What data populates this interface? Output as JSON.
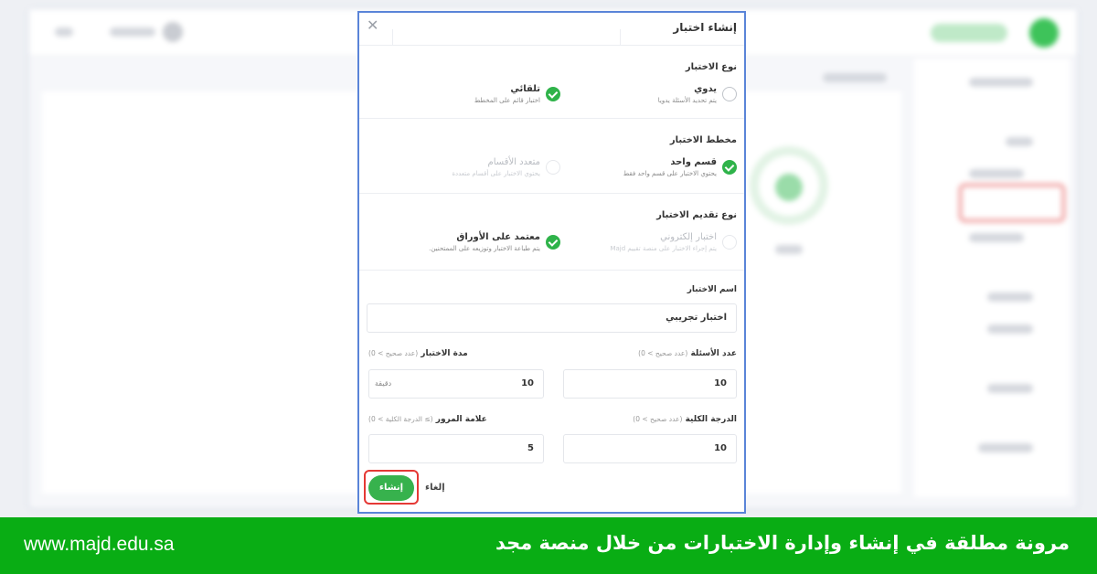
{
  "dialog": {
    "title": "إنشاء اختبار",
    "close_icon": "close-icon",
    "test_type": {
      "title": "نوع الاختبار",
      "manual": {
        "label": "يدوي",
        "desc": "يتم تحديد الأسئلة يدويا",
        "selected": false
      },
      "automatic": {
        "label": "تلقائي",
        "desc": "اختبار قائم على المخطط",
        "selected": true
      }
    },
    "test_plan": {
      "title": "مخطط الاختبار",
      "single": {
        "label": "قسم واحد",
        "desc": "يحتوي الاختبار على قسم واحد فقط",
        "selected": true
      },
      "multi": {
        "label": "متعدد الأقسام",
        "desc": "يحتوي الاختبار على أقسام متعددة",
        "selected": false,
        "disabled": true
      }
    },
    "delivery": {
      "title": "نوع تقديم الاختبار",
      "electronic": {
        "label": "اختبار إلكتروني",
        "desc": "يتم إجراء الاختبار على منصة تقييم Majd",
        "selected": false,
        "disabled": true
      },
      "paper": {
        "label": "معتمد على الأوراق",
        "desc": "يتم طباعة الاختبار وتوزيعه على الممتحنين.",
        "selected": true
      }
    },
    "name": {
      "label": "اسم الاختبار",
      "value": "اختبار  تجريبي"
    },
    "questions_count": {
      "label": "عدد الأسئلة",
      "hint": "(عدد صحيح > 0)",
      "value": "10"
    },
    "duration": {
      "label": "مدة الاختبار",
      "hint": "(عدد صحيح > 0)",
      "value": "10",
      "suffix": "دقيقة"
    },
    "total_score": {
      "label": "الدرجة الكلية",
      "hint": "(عدد صحيح > 0)",
      "value": "10"
    },
    "pass_mark": {
      "label": "علامة المرور",
      "hint": "(≥ الدرجة الكلية > 0)",
      "value": "5"
    },
    "create_label": "إنشاء",
    "cancel_label": "إلغاء"
  },
  "banner": {
    "url": "www.majd.edu.sa",
    "text": "مرونة مطلقة في إنشاء وإدارة الاختبارات من خلال منصة مجد"
  },
  "colors": {
    "accent_green": "#37b24d",
    "banner_green": "#09ad14",
    "highlight_red": "#e53935",
    "dialog_border": "#5a84d8"
  }
}
